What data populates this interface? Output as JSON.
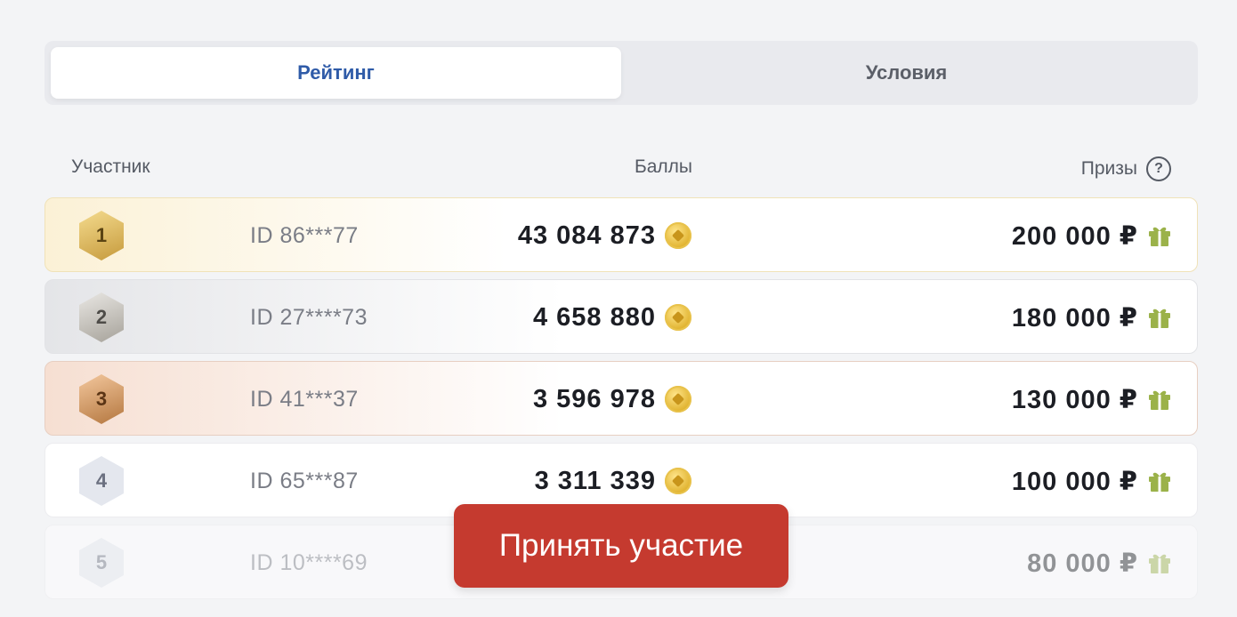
{
  "tabs": [
    {
      "label": "Рейтинг",
      "active": true
    },
    {
      "label": "Условия",
      "active": false
    }
  ],
  "headers": {
    "participant": "Участник",
    "points": "Баллы",
    "prizes": "Призы",
    "help_icon_glyph": "?"
  },
  "rows": [
    {
      "rank": "1",
      "id": "ID 86***77",
      "points": "43 084 873",
      "prize": "200 000 ₽",
      "tier": "gold"
    },
    {
      "rank": "2",
      "id": "ID 27****73",
      "points": "4 658 880",
      "prize": "180 000 ₽",
      "tier": "silver"
    },
    {
      "rank": "3",
      "id": "ID 41***37",
      "points": "3 596 978",
      "prize": "130 000 ₽",
      "tier": "bronze"
    },
    {
      "rank": "4",
      "id": "ID 65***87",
      "points": "3 311 339",
      "prize": "100 000 ₽",
      "tier": "plain"
    },
    {
      "rank": "5",
      "id": "ID 10****69",
      "points": "",
      "prize": "80 000 ₽",
      "tier": "plain"
    }
  ],
  "cta": {
    "label": "Принять участие"
  },
  "icons": {
    "coin": "coin-icon",
    "gift": "gift-icon",
    "help": "help-icon"
  },
  "colors": {
    "accent_tab": "#2f5ba8",
    "cta": "#c53a2f",
    "gift": "#9bb24a",
    "coin": "#e0b22e"
  }
}
